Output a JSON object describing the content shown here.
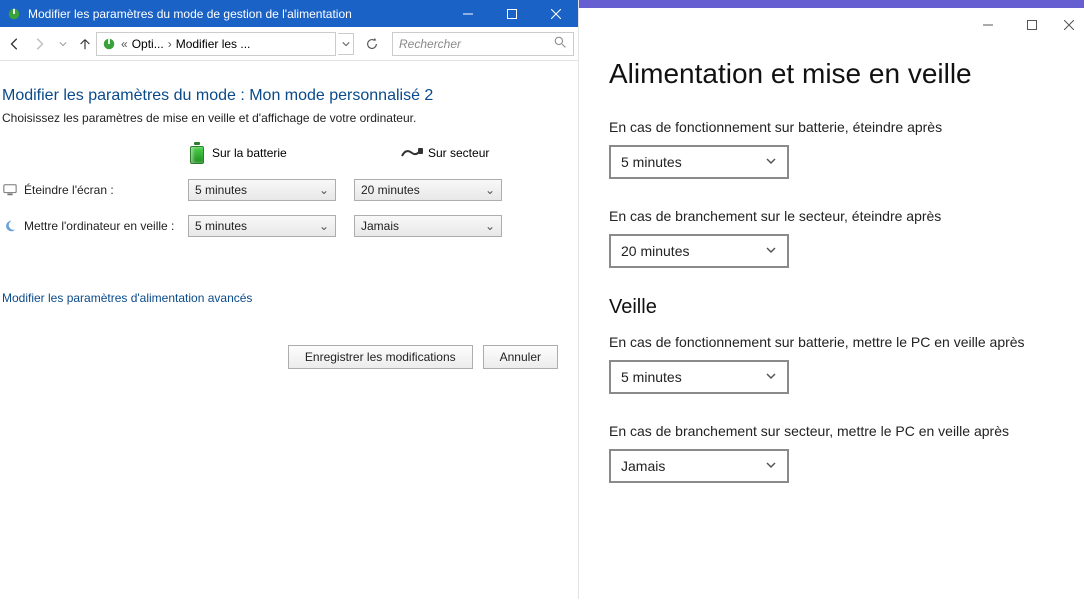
{
  "cp": {
    "title": "Modifier les paramètres du mode de gestion de l'alimentation",
    "breadcrumb": {
      "seg1": "Opti...",
      "seg2": "Modifier les ..."
    },
    "search_placeholder": "Rechercher",
    "heading": "Modifier les paramètres du mode : Mon mode personnalisé 2",
    "subtext": "Choisissez les paramètres de mise en veille et d'affichage de votre ordinateur.",
    "col_battery": "Sur la batterie",
    "col_plugged": "Sur secteur",
    "rows": {
      "screen_off": {
        "label": "Éteindre l'écran :",
        "battery": "5 minutes",
        "plugged": "20 minutes"
      },
      "sleep": {
        "label": "Mettre l'ordinateur en veille :",
        "battery": "5 minutes",
        "plugged": "Jamais"
      }
    },
    "adv_link": "Modifier les paramètres d'alimentation avancés",
    "save_btn": "Enregistrer les modifications",
    "cancel_btn": "Annuler"
  },
  "settings": {
    "title": "Alimentation et mise en veille",
    "screen_battery_label": "En cas de fonctionnement sur batterie, éteindre après",
    "screen_battery_value": "5 minutes",
    "screen_ac_label": "En cas de branchement sur le secteur, éteindre après",
    "screen_ac_value": "20 minutes",
    "sleep_heading": "Veille",
    "sleep_battery_label": "En cas de fonctionnement sur batterie, mettre le PC en veille après",
    "sleep_battery_value": "5 minutes",
    "sleep_ac_label": "En cas de branchement sur secteur, mettre le PC en veille après",
    "sleep_ac_value": "Jamais"
  }
}
